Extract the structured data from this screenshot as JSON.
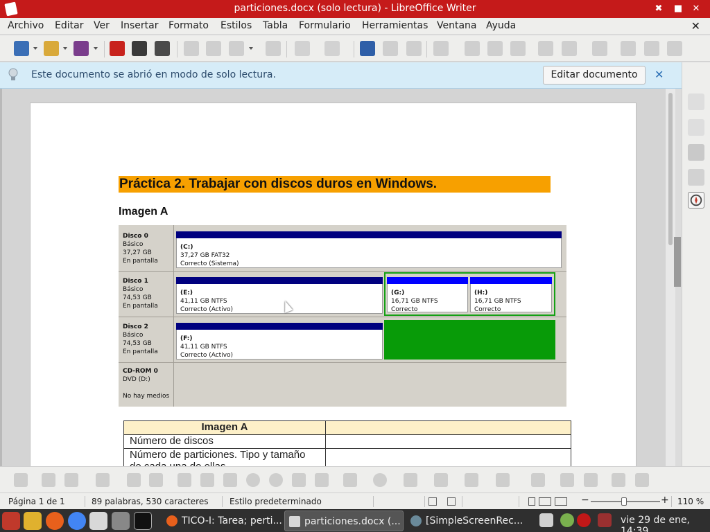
{
  "window": {
    "title": "particiones.docx (solo lectura) - LibreOffice Writer",
    "controls": [
      "✖",
      "■",
      "✕"
    ]
  },
  "menubar": {
    "items": [
      "Archivo",
      "Editar",
      "Ver",
      "Insertar",
      "Formato",
      "Estilos",
      "Tabla",
      "Formulario",
      "Herramientas",
      "Ventana",
      "Ayuda"
    ],
    "close": "✕"
  },
  "infobar": {
    "message": "Este documento se abrió en modo de solo lectura.",
    "edit_button": "Editar documento",
    "close": "✕"
  },
  "document": {
    "heading": "Práctica 2. Trabajar con discos duros en Windows.",
    "subheading": "Imagen A",
    "disks": [
      {
        "name": "Disco 0",
        "type": "Básico",
        "size": "37,27 GB",
        "state": "En pantalla",
        "partitions": [
          {
            "name": "(C:)",
            "info": "37,27 GB FAT32",
            "status": "Correcto (Sistema)"
          }
        ]
      },
      {
        "name": "Disco 1",
        "type": "Básico",
        "size": "74,53 GB",
        "state": "En pantalla",
        "partitions": [
          {
            "name": "(E:)",
            "info": "41,11 GB NTFS",
            "status": "Correcto (Activo)"
          },
          {
            "name": "(G:)",
            "info": "16,71 GB NTFS",
            "status": "Correcto"
          },
          {
            "name": "(H:)",
            "info": "16,71 GB NTFS",
            "status": "Correcto"
          }
        ]
      },
      {
        "name": "Disco 2",
        "type": "Básico",
        "size": "74,53 GB",
        "state": "En pantalla",
        "partitions": [
          {
            "name": "(F:)",
            "info": "41,11 GB NTFS",
            "status": "Correcto (Activo)"
          }
        ]
      },
      {
        "name": "CD-ROM 0",
        "type": "DVD (D:)",
        "size": "",
        "state": "No hay medios",
        "partitions": []
      }
    ],
    "table": {
      "header": [
        "Imagen A",
        ""
      ],
      "rows": [
        [
          "Número de discos",
          ""
        ],
        [
          "Número de particiones. Tipo y tamaño de cada una de ellas",
          ""
        ]
      ]
    }
  },
  "statusbar": {
    "page": "Página 1 de 1",
    "words": "89 palabras, 530 caracteres",
    "style": "Estilo predeterminado",
    "zoom_minus": "−",
    "zoom_plus": "+",
    "zoom": "110 %"
  },
  "taskbar": {
    "tasks": [
      {
        "label": "TICO-I: Tarea; perti...",
        "active": false
      },
      {
        "label": "particiones.docx (...",
        "active": true
      },
      {
        "label": "[SimpleScreenRec...",
        "active": false
      }
    ],
    "clock": "vie 29 de ene, 14:39"
  },
  "colors": {
    "titlebar": "#c51a1a",
    "heading_bg": "#f7a000",
    "infobar": "#d6ecf8",
    "primary_partition": "#00007f",
    "logical_partition": "#0000ff",
    "free_space": "#089b08"
  }
}
